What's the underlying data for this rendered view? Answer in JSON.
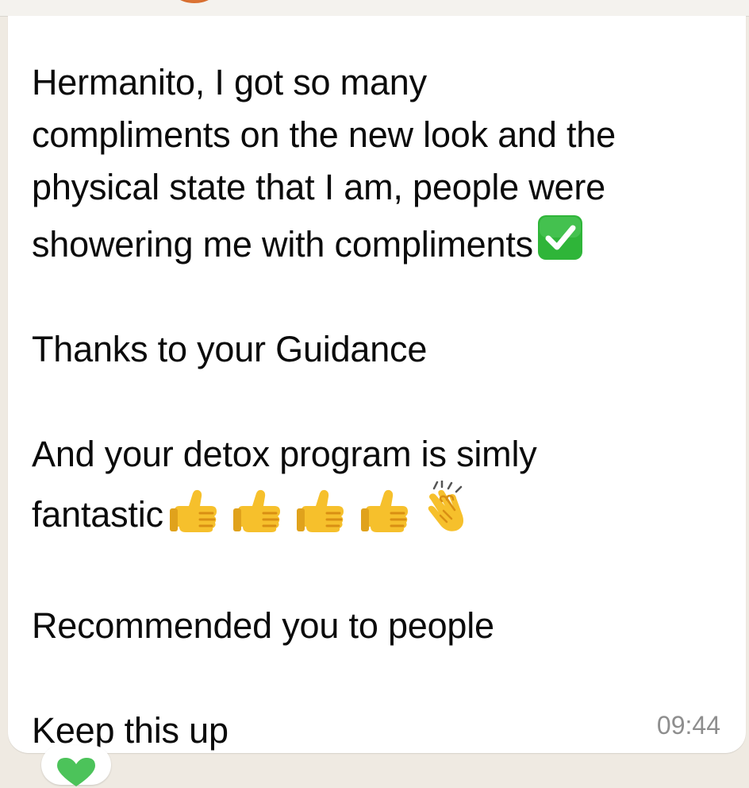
{
  "message": {
    "lines": [
      "Hermanito, I got so many",
      "compliments on the new look and the",
      "physical state that I am, people were",
      "showering me with compliments"
    ],
    "line_thanks": "Thanks to your Guidance",
    "line_detox_1": "And your detox program is simly",
    "line_detox_2": "fantastic",
    "line_recommended": "Recommended you to people",
    "line_keep": "Keep this up",
    "timestamp": "09:44"
  },
  "icons": {
    "check": "white-check-mark-emoji",
    "thumbs": [
      "thumbs-up-emoji",
      "thumbs-up-emoji",
      "thumbs-up-emoji",
      "thumbs-up-emoji"
    ],
    "clap": "clapping-hands-emoji",
    "reaction": "green-heart-emoji"
  },
  "colors": {
    "bubble": "#ffffff",
    "chat_background": "#efeae2",
    "text": "#0b0b0b",
    "timestamp": "#8e8e8e",
    "check_green": "#2fb539",
    "emoji_yellow": "#f6c02c"
  }
}
